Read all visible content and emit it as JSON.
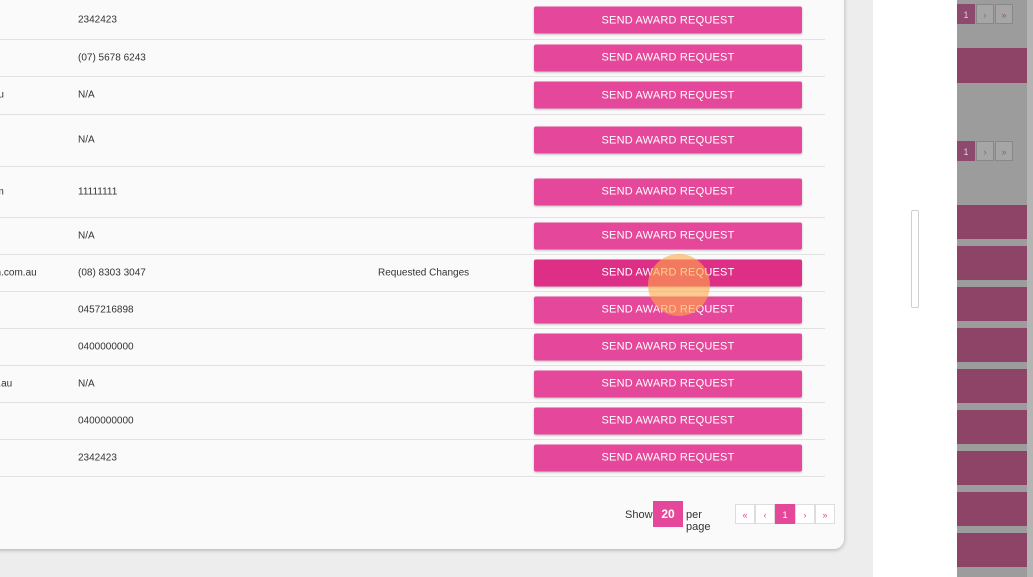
{
  "colors": {
    "accent": "#e5489a",
    "accent_active": "#de2f87"
  },
  "table": {
    "rows": [
      {
        "email": "",
        "phone": "2342423",
        "status": "",
        "button": "SEND AWARD REQUEST"
      },
      {
        "email": "",
        "phone": "(07) 5678 6243",
        "status": "",
        "button": "SEND AWARD REQUEST"
      },
      {
        "email": ".au",
        "phone": "N/A",
        "status": "",
        "button": "SEND AWARD REQUEST"
      },
      {
        "email": "",
        "phone": "N/A",
        "status": "",
        "button": "SEND AWARD REQUEST"
      },
      {
        "email": "om",
        "phone": "11111111",
        "status": "",
        "button": "SEND AWARD REQUEST"
      },
      {
        "email": "",
        "phone": "N/A",
        "status": "",
        "button": "SEND AWARD REQUEST"
      },
      {
        "email": "on.com.au",
        "phone": "(08) 8303 3047",
        "status": "Requested Changes",
        "button": "SEND AWARD REQUEST"
      },
      {
        "email": "",
        "phone": "0457216898",
        "status": "",
        "button": "SEND AWARD REQUEST"
      },
      {
        "email": "",
        "phone": "0400000000",
        "status": "",
        "button": "SEND AWARD REQUEST"
      },
      {
        "email": "m.au",
        "phone": "N/A",
        "status": "",
        "button": "SEND AWARD REQUEST"
      },
      {
        "email": "",
        "phone": "0400000000",
        "status": "",
        "button": "SEND AWARD REQUEST"
      },
      {
        "email": "",
        "phone": "2342423",
        "status": "",
        "button": "SEND AWARD REQUEST"
      }
    ]
  },
  "pagination": {
    "show_label": "Show",
    "per_page": "20",
    "per_page_label": "per page",
    "first": "«",
    "prev": "‹",
    "current_page": "1",
    "next": "›",
    "last": "»"
  },
  "background_panel": {
    "pager_current": "1",
    "pager_next": "›",
    "pager_last": "»"
  }
}
